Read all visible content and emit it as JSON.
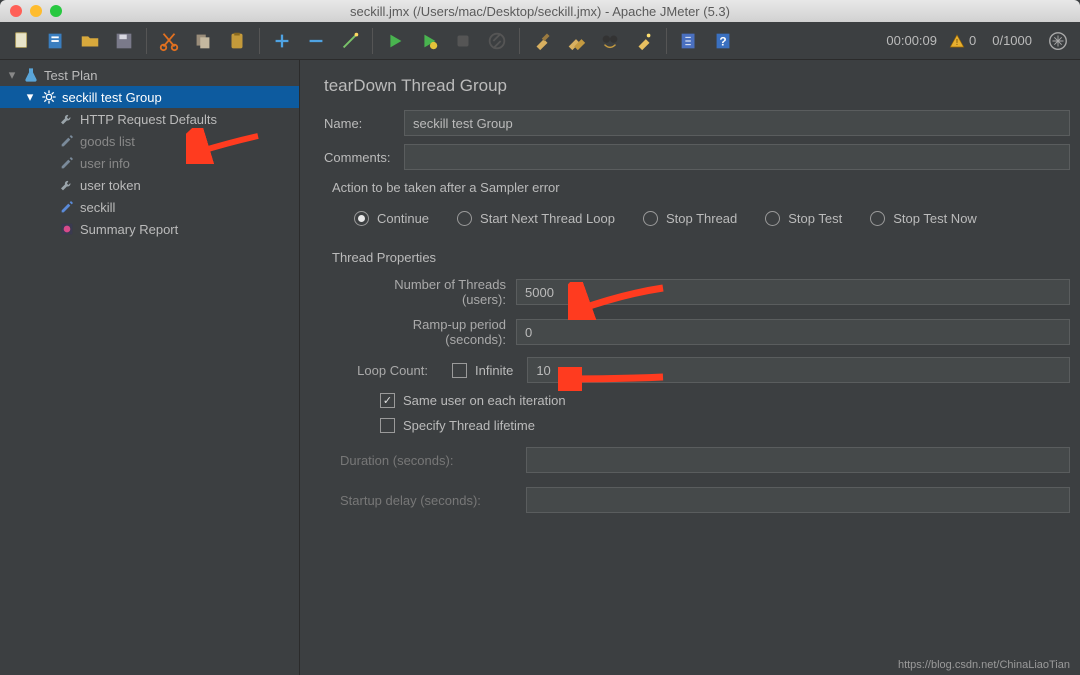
{
  "window": {
    "title": "seckill.jmx (/Users/mac/Desktop/seckill.jmx) - Apache JMeter (5.3)"
  },
  "status": {
    "timer": "00:00:09",
    "warnings": "0",
    "active_threads": "0/1000"
  },
  "tree": {
    "root": "Test Plan",
    "group": "seckill test Group",
    "items": [
      "HTTP Request Defaults",
      "goods list",
      "user info",
      "user token",
      "seckill",
      "Summary Report"
    ]
  },
  "panel": {
    "heading": "tearDown Thread Group",
    "labels": {
      "name": "Name:",
      "comments": "Comments:",
      "action_legend": "Action to be taken after a Sampler error",
      "thread_props": "Thread Properties",
      "num_threads": "Number of Threads (users):",
      "ramp_up": "Ramp-up period (seconds):",
      "loop_count": "Loop Count:",
      "infinite": "Infinite",
      "same_user": "Same user on each iteration",
      "specify_lt": "Specify Thread lifetime",
      "duration": "Duration (seconds):",
      "startup_delay": "Startup delay (seconds):"
    },
    "values": {
      "name": "seckill test Group",
      "comments": "",
      "num_threads": "5000",
      "ramp_up": "0",
      "loop_count": "10"
    },
    "radios": {
      "continue": "Continue",
      "start_next": "Start Next Thread Loop",
      "stop_thread": "Stop Thread",
      "stop_test": "Stop Test",
      "stop_test_now": "Stop Test Now"
    }
  },
  "footer": "https://blog.csdn.net/ChinaLiaoTian"
}
